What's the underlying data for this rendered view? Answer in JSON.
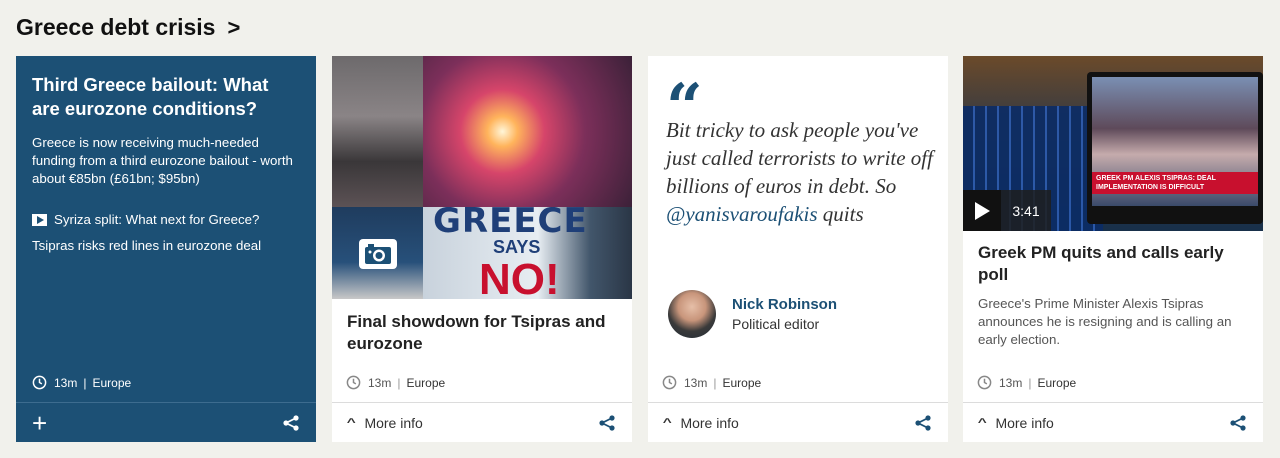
{
  "section": {
    "title": "Greece debt crisis",
    "chevron": ">"
  },
  "cards": [
    {
      "headline": "Third Greece bailout: What are eurozone conditions?",
      "summary": "Greece is now receiving much-needed funding from a third eurozone bailout - worth about €85bn (£61bn; $95bn)",
      "related": [
        {
          "label": "Syriza split: What next for Greece?",
          "icon": "video-icon"
        },
        {
          "label": "Tsipras risks red lines in eurozone deal"
        }
      ],
      "time": "13m",
      "section": "Europe",
      "colors": {
        "background": "#1c5075"
      }
    },
    {
      "headline": "Final showdown for Tsipras and eurozone",
      "media": {
        "type": "gallery",
        "icon": "camera-icon",
        "poster_text": [
          "GREECE",
          "SAYS",
          "NO!"
        ]
      },
      "time": "13m",
      "section": "Europe",
      "more_info": "More info"
    },
    {
      "quote": "Bit tricky to ask people you've just called terrorists to write off billions of euros in debt. So ",
      "quote_handle": "@yanisvaroufakis",
      "quote_end": " quits",
      "author": {
        "name": "Nick Robinson",
        "role": "Political editor"
      },
      "time": "13m",
      "section": "Europe",
      "more_info": "More info"
    },
    {
      "headline": "Greek PM quits and calls early poll",
      "summary": "Greece's Prime Minister Alexis Tsipras announces he is resigning and is calling an early election.",
      "video": {
        "duration": "3:41",
        "ticker": [
          "GREEK PM ALEXIS TSIPRAS: DEAL",
          "IMPLEMENTATION IS DIFFICULT"
        ]
      },
      "time": "13m",
      "section": "Europe",
      "more_info": "More info"
    }
  ],
  "colors": {
    "accent": "#1c5075",
    "page_bg": "#f1f1ec"
  }
}
